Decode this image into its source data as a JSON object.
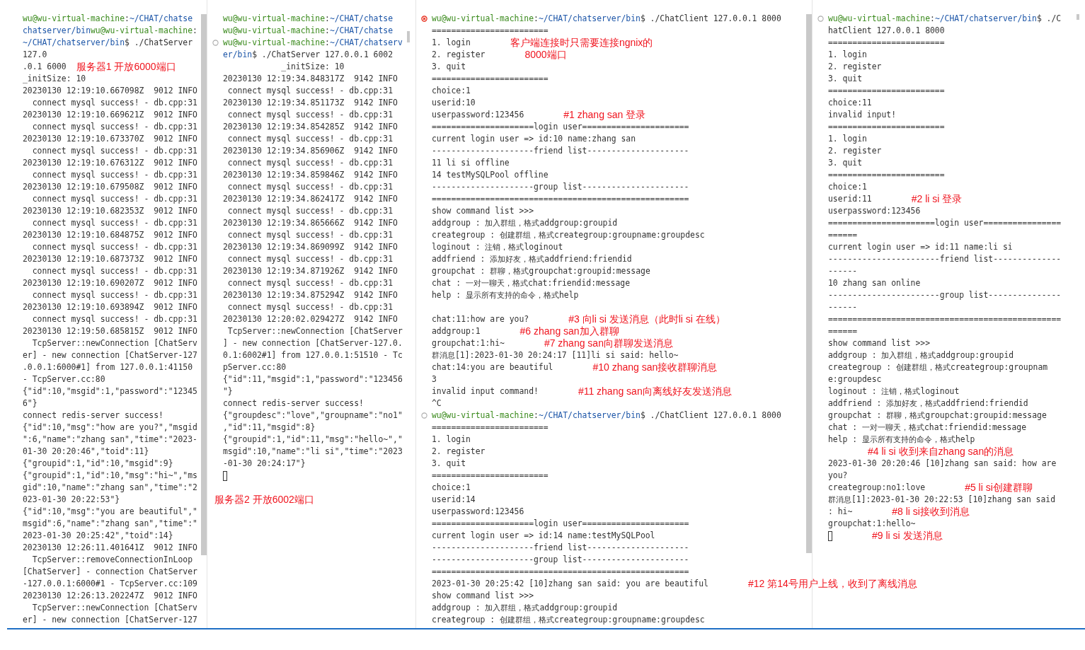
{
  "panes": [
    {
      "lines": [
        {
          "kind": "prompt",
          "parts": [
            {
              "kind": "user",
              "text": "wu@wu-virtual-machine"
            },
            {
              "kind": "plain",
              "text": ":"
            },
            {
              "kind": "path",
              "text": "~/CHAT/chatse"
            }
          ]
        },
        {
          "kind": "prompt",
          "parts": [
            {
              "kind": "path",
              "text": "chatserver/bin"
            },
            {
              "kind": "user",
              "text": "wu@wu-virtual-machine"
            },
            {
              "kind": "plain",
              "text": ":"
            }
          ]
        },
        {
          "kind": "prompt",
          "parts": [
            {
              "kind": "path",
              "text": "~/CHAT/chatserver/bin"
            },
            {
              "kind": "plain",
              "text": "$ ./ChatServer"
            }
          ]
        },
        {
          "kind": "text",
          "text": "127.0"
        },
        {
          "kind": "text",
          "text": ".0.1 6000",
          "note": "服务器1 开放6000端口"
        },
        {
          "kind": "text",
          "text": "_initSize: 10"
        },
        {
          "kind": "text",
          "text": "20230130 12:19:10.667098Z  9012 INFO"
        },
        {
          "kind": "text",
          "text": "  connect mysql success! - db.cpp:31"
        },
        {
          "kind": "text",
          "text": "20230130 12:19:10.669621Z  9012 INFO"
        },
        {
          "kind": "text",
          "text": "  connect mysql success! - db.cpp:31"
        },
        {
          "kind": "text",
          "text": "20230130 12:19:10.673370Z  9012 INFO"
        },
        {
          "kind": "text",
          "text": "  connect mysql success! - db.cpp:31"
        },
        {
          "kind": "text",
          "text": "20230130 12:19:10.676312Z  9012 INFO"
        },
        {
          "kind": "text",
          "text": "  connect mysql success! - db.cpp:31"
        },
        {
          "kind": "text",
          "text": "20230130 12:19:10.679508Z  9012 INFO"
        },
        {
          "kind": "text",
          "text": "  connect mysql success! - db.cpp:31"
        },
        {
          "kind": "text",
          "text": "20230130 12:19:10.682353Z  9012 INFO"
        },
        {
          "kind": "text",
          "text": "  connect mysql success! - db.cpp:31"
        },
        {
          "kind": "text",
          "text": "20230130 12:19:10.684875Z  9012 INFO"
        },
        {
          "kind": "text",
          "text": "  connect mysql success! - db.cpp:31"
        },
        {
          "kind": "text",
          "text": "20230130 12:19:10.687373Z  9012 INFO"
        },
        {
          "kind": "text",
          "text": "  connect mysql success! - db.cpp:31"
        },
        {
          "kind": "text",
          "text": "20230130 12:19:10.690207Z  9012 INFO"
        },
        {
          "kind": "text",
          "text": "  connect mysql success! - db.cpp:31"
        },
        {
          "kind": "text",
          "text": "20230130 12:19:10.693894Z  9012 INFO"
        },
        {
          "kind": "text",
          "text": "  connect mysql success! - db.cpp:31"
        },
        {
          "kind": "text",
          "text": "20230130 12:19:50.685815Z  9012 INFO"
        },
        {
          "kind": "text",
          "text": "  TcpServer::newConnection [ChatServ"
        },
        {
          "kind": "text",
          "text": "er] - new connection [ChatServer-127"
        },
        {
          "kind": "text",
          "text": ".0.0.1:6000#1] from 127.0.0.1:41150"
        },
        {
          "kind": "text",
          "text": "- TcpServer.cc:80"
        },
        {
          "kind": "text",
          "text": "{\"id\":10,\"msgid\":1,\"password\":\"12345"
        },
        {
          "kind": "text",
          "text": "6\"}"
        },
        {
          "kind": "text",
          "text": "connect redis-server success!"
        },
        {
          "kind": "text",
          "text": "{\"id\":10,\"msg\":\"how are you?\",\"msgid"
        },
        {
          "kind": "text",
          "text": "\":6,\"name\":\"zhang san\",\"time\":\"2023-"
        },
        {
          "kind": "text",
          "text": "01-30 20:20:46\",\"toid\":11}"
        },
        {
          "kind": "text",
          "text": "{\"groupid\":1,\"id\":10,\"msgid\":9}"
        },
        {
          "kind": "text",
          "text": "{\"groupid\":1,\"id\":10,\"msg\":\"hi~\",\"ms"
        },
        {
          "kind": "text",
          "text": "gid\":10,\"name\":\"zhang san\",\"time\":\"2"
        },
        {
          "kind": "text",
          "text": "023-01-30 20:22:53\"}"
        },
        {
          "kind": "text",
          "text": "{\"id\":10,\"msg\":\"you are beautiful\",\""
        },
        {
          "kind": "text",
          "text": "msgid\":6,\"name\":\"zhang san\",\"time\":\""
        },
        {
          "kind": "text",
          "text": "2023-01-30 20:25:42\",\"toid\":14}"
        },
        {
          "kind": "text",
          "text": "20230130 12:26:11.401641Z  9012 INFO"
        },
        {
          "kind": "text",
          "text": "  TcpServer::removeConnectionInLoop"
        },
        {
          "kind": "text",
          "text": "[ChatServer] - connection ChatServer"
        },
        {
          "kind": "text",
          "text": "-127.0.0.1:6000#1 - TcpServer.cc:109"
        },
        {
          "kind": "text",
          "text": "20230130 12:26:13.202247Z  9012 INFO"
        },
        {
          "kind": "text",
          "text": "  TcpServer::newConnection [ChatServ"
        },
        {
          "kind": "text",
          "text": "er] - new connection [ChatServer-127"
        }
      ]
    },
    {
      "lines": [
        {
          "kind": "prompt",
          "parts": [
            {
              "kind": "user",
              "text": "wu@wu-virtual-machine"
            },
            {
              "kind": "plain",
              "text": ":"
            },
            {
              "kind": "path",
              "text": "~/CHAT/chatse"
            }
          ]
        },
        {
          "kind": "prompt",
          "parts": [
            {
              "kind": "user",
              "text": "wu@wu-virtual-machine"
            },
            {
              "kind": "plain",
              "text": ":"
            },
            {
              "kind": "path",
              "text": "~/CHAT/chatse"
            }
          ]
        },
        {
          "kind": "prompt",
          "failed": false,
          "parts": [
            {
              "kind": "user",
              "text": "wu@wu-virtual-machine"
            },
            {
              "kind": "plain",
              "text": ":"
            },
            {
              "kind": "path",
              "text": "~/CHAT/chatserv"
            }
          ]
        },
        {
          "kind": "prompt",
          "parts": [
            {
              "kind": "path",
              "text": "er/bin"
            },
            {
              "kind": "plain",
              "text": "$ ./ChatServer 127.0.0.1 6002"
            }
          ]
        },
        {
          "kind": "text",
          "text": "            _initSize: 10"
        },
        {
          "kind": "text",
          "text": "20230130 12:19:34.848317Z  9142 INFO"
        },
        {
          "kind": "text",
          "text": " connect mysql success! - db.cpp:31"
        },
        {
          "kind": "text",
          "text": "20230130 12:19:34.851173Z  9142 INFO"
        },
        {
          "kind": "text",
          "text": " connect mysql success! - db.cpp:31"
        },
        {
          "kind": "text",
          "text": "20230130 12:19:34.854285Z  9142 INFO"
        },
        {
          "kind": "text",
          "text": " connect mysql success! - db.cpp:31"
        },
        {
          "kind": "text",
          "text": "20230130 12:19:34.856906Z  9142 INFO"
        },
        {
          "kind": "text",
          "text": " connect mysql success! - db.cpp:31"
        },
        {
          "kind": "text",
          "text": "20230130 12:19:34.859846Z  9142 INFO"
        },
        {
          "kind": "text",
          "text": " connect mysql success! - db.cpp:31"
        },
        {
          "kind": "text",
          "text": "20230130 12:19:34.862417Z  9142 INFO"
        },
        {
          "kind": "text",
          "text": " connect mysql success! - db.cpp:31"
        },
        {
          "kind": "text",
          "text": "20230130 12:19:34.865666Z  9142 INFO"
        },
        {
          "kind": "text",
          "text": " connect mysql success! - db.cpp:31"
        },
        {
          "kind": "text",
          "text": "20230130 12:19:34.869099Z  9142 INFO"
        },
        {
          "kind": "text",
          "text": " connect mysql success! - db.cpp:31"
        },
        {
          "kind": "text",
          "text": "20230130 12:19:34.871926Z  9142 INFO"
        },
        {
          "kind": "text",
          "text": " connect mysql success! - db.cpp:31"
        },
        {
          "kind": "text",
          "text": "20230130 12:19:34.875294Z  9142 INFO"
        },
        {
          "kind": "text",
          "text": " connect mysql success! - db.cpp:31"
        },
        {
          "kind": "text",
          "text": "20230130 12:20:02.029427Z  9142 INFO"
        },
        {
          "kind": "text",
          "text": " TcpServer::newConnection [ChatServer"
        },
        {
          "kind": "text",
          "text": "] - new connection [ChatServer-127.0."
        },
        {
          "kind": "text",
          "text": "0.1:6002#1] from 127.0.0.1:51510 - Tc"
        },
        {
          "kind": "text",
          "text": "pServer.cc:80"
        },
        {
          "kind": "text",
          "text": "{\"id\":11,\"msgid\":1,\"password\":\"123456"
        },
        {
          "kind": "text",
          "text": "\"}"
        },
        {
          "kind": "text",
          "text": "connect redis-server success!"
        },
        {
          "kind": "text",
          "text": "{\"groupdesc\":\"love\",\"groupname\":\"no1\""
        },
        {
          "kind": "text",
          "text": ",\"id\":11,\"msgid\":8}"
        },
        {
          "kind": "text",
          "text": "{\"groupid\":1,\"id\":11,\"msg\":\"hello~\",\""
        },
        {
          "kind": "text",
          "text": "msgid\":10,\"name\":\"li si\",\"time\":\"2023"
        },
        {
          "kind": "text",
          "text": "-01-30 20:24:17\"}"
        },
        {
          "kind": "cursor"
        },
        {
          "kind": "blank"
        },
        {
          "kind": "note",
          "note": "服务器2 开放6002端口"
        }
      ]
    },
    {
      "lines": [
        {
          "kind": "prompt",
          "failed": true,
          "parts": [
            {
              "kind": "user",
              "text": "wu@wu-virtual-machine"
            },
            {
              "kind": "plain",
              "text": ":"
            },
            {
              "kind": "path",
              "text": "~/CHAT/chatserver/bin"
            },
            {
              "kind": "plain",
              "text": "$ ./ChatClient 127.0.0.1 8000"
            }
          ]
        },
        {
          "kind": "text",
          "text": "========================"
        },
        {
          "kind": "text",
          "text": "1. login",
          "note": "客户端连接时只需要连接ngnix的"
        },
        {
          "kind": "text",
          "text": "2. register",
          "note": "8000端口"
        },
        {
          "kind": "text",
          "text": "3. quit"
        },
        {
          "kind": "text",
          "text": "========================"
        },
        {
          "kind": "text",
          "text": "choice:1"
        },
        {
          "kind": "text",
          "text": "userid:10"
        },
        {
          "kind": "text",
          "text": "userpassword:123456",
          "note": "#1 zhang san 登录"
        },
        {
          "kind": "text",
          "text": "=====================login user======================"
        },
        {
          "kind": "text",
          "text": "current login user => id:10 name:zhang san"
        },
        {
          "kind": "text",
          "text": "---------------------friend list---------------------"
        },
        {
          "kind": "text",
          "text": "11 li si offline"
        },
        {
          "kind": "text",
          "text": "14 testMySQLPool offline"
        },
        {
          "kind": "text",
          "text": "---------------------group list----------------------"
        },
        {
          "kind": "text",
          "text": "====================================================="
        },
        {
          "kind": "text",
          "text": "show command list >>>"
        },
        {
          "kind": "text",
          "text": "addgroup : 加入群组，格式addgroup:groupid"
        },
        {
          "kind": "text",
          "text": "creategroup : 创建群组，格式creategroup:groupname:groupdesc"
        },
        {
          "kind": "text",
          "text": "loginout : 注销，格式loginout"
        },
        {
          "kind": "text",
          "text": "addfriend : 添加好友，格式addfriend:friendid"
        },
        {
          "kind": "text",
          "text": "groupchat : 群聊，格式groupchat:groupid:message"
        },
        {
          "kind": "text",
          "text": "chat : 一对一聊天，格式chat:friendid:message"
        },
        {
          "kind": "text",
          "text": "help : 显示所有支持的命令，格式help"
        },
        {
          "kind": "blank"
        },
        {
          "kind": "text",
          "text": "chat:11:how are you?",
          "note": "#3 向li si 发送消息（此时li si 在线）"
        },
        {
          "kind": "text",
          "text": "addgroup:1",
          "note": "#6 zhang san加入群聊"
        },
        {
          "kind": "text",
          "text": "groupchat:1:hi~",
          "note": "#7 zhang san向群聊发送消息"
        },
        {
          "kind": "text",
          "text": "群消息[1]:2023-01-30 20:24:17 [11]li si said: hello~"
        },
        {
          "kind": "text",
          "text": "chat:14:you are beautiful",
          "note": "#10 zhang san接收群聊消息"
        },
        {
          "kind": "text",
          "text": "3"
        },
        {
          "kind": "text",
          "text": "invalid input command!",
          "note": "#11 zhang san向离线好友发送消息"
        },
        {
          "kind": "text",
          "text": "^C"
        },
        {
          "kind": "prompt",
          "failed": false,
          "parts": [
            {
              "kind": "user",
              "text": "wu@wu-virtual-machine"
            },
            {
              "kind": "plain",
              "text": ":"
            },
            {
              "kind": "path",
              "text": "~/CHAT/chatserver/bin"
            },
            {
              "kind": "plain",
              "text": "$ ./ChatClient 127.0.0.1 8000"
            }
          ]
        },
        {
          "kind": "text",
          "text": "========================"
        },
        {
          "kind": "text",
          "text": "1. login"
        },
        {
          "kind": "text",
          "text": "2. register"
        },
        {
          "kind": "text",
          "text": "3. quit"
        },
        {
          "kind": "text",
          "text": "========================"
        },
        {
          "kind": "text",
          "text": "choice:1"
        },
        {
          "kind": "text",
          "text": "userid:14"
        },
        {
          "kind": "text",
          "text": "userpassword:123456"
        },
        {
          "kind": "text",
          "text": "=====================login user======================"
        },
        {
          "kind": "text",
          "text": "current login user => id:14 name:testMySQLPool"
        },
        {
          "kind": "text",
          "text": "---------------------friend list---------------------"
        },
        {
          "kind": "text",
          "text": "---------------------group list----------------------"
        },
        {
          "kind": "text",
          "text": "====================================================="
        },
        {
          "kind": "text",
          "text": "2023-01-30 20:25:42 [10]zhang san said: you are beautiful",
          "note": "#12 第14号用户上线，收到了离线消息"
        },
        {
          "kind": "text",
          "text": "show command list >>>"
        },
        {
          "kind": "text",
          "text": "addgroup : 加入群组，格式addgroup:groupid"
        },
        {
          "kind": "text",
          "text": "creategroup : 创建群组，格式creategroup:groupname:groupdesc"
        }
      ]
    },
    {
      "lines": [
        {
          "kind": "prompt",
          "failed": false,
          "parts": [
            {
              "kind": "user",
              "text": "wu@wu-virtual-machine"
            },
            {
              "kind": "plain",
              "text": ":"
            },
            {
              "kind": "path",
              "text": "~/CHAT/chatserver/bin"
            },
            {
              "kind": "plain",
              "text": "$ ./C"
            }
          ]
        },
        {
          "kind": "text",
          "text": "hatClient 127.0.0.1 8000"
        },
        {
          "kind": "text",
          "text": "========================"
        },
        {
          "kind": "text",
          "text": "1. login"
        },
        {
          "kind": "text",
          "text": "2. register"
        },
        {
          "kind": "text",
          "text": "3. quit"
        },
        {
          "kind": "text",
          "text": "========================"
        },
        {
          "kind": "text",
          "text": "choice:11"
        },
        {
          "kind": "text",
          "text": "invalid input!"
        },
        {
          "kind": "text",
          "text": "========================"
        },
        {
          "kind": "text",
          "text": "1. login"
        },
        {
          "kind": "text",
          "text": "2. register"
        },
        {
          "kind": "text",
          "text": "3. quit"
        },
        {
          "kind": "text",
          "text": "========================"
        },
        {
          "kind": "text",
          "text": "choice:1"
        },
        {
          "kind": "text",
          "text": "userid:11",
          "note": "#2 li si 登录"
        },
        {
          "kind": "text",
          "text": "userpassword:123456"
        },
        {
          "kind": "text",
          "text": "======================login user================"
        },
        {
          "kind": "text",
          "text": "======"
        },
        {
          "kind": "text",
          "text": "current login user => id:11 name:li si"
        },
        {
          "kind": "text",
          "text": "-----------------------friend list--------------"
        },
        {
          "kind": "text",
          "text": "------"
        },
        {
          "kind": "text",
          "text": "10 zhang san online"
        },
        {
          "kind": "text",
          "text": "-----------------------group list---------------"
        },
        {
          "kind": "text",
          "text": "------"
        },
        {
          "kind": "text",
          "text": "================================================"
        },
        {
          "kind": "text",
          "text": "======"
        },
        {
          "kind": "text",
          "text": "show command list >>>"
        },
        {
          "kind": "text",
          "text": "addgroup : 加入群组，格式addgroup:groupid"
        },
        {
          "kind": "text",
          "text": "creategroup : 创建群组，格式creategroup:groupnam"
        },
        {
          "kind": "text",
          "text": "e:groupdesc"
        },
        {
          "kind": "text",
          "text": "loginout : 注销，格式loginout"
        },
        {
          "kind": "text",
          "text": "addfriend : 添加好友，格式addfriend:friendid"
        },
        {
          "kind": "text",
          "text": "groupchat : 群聊，格式groupchat:groupid:message"
        },
        {
          "kind": "text",
          "text": "chat : 一对一聊天，格式chat:friendid:message"
        },
        {
          "kind": "text",
          "text": "help : 显示所有支持的命令，格式help"
        },
        {
          "kind": "note",
          "note": "#4 li si 收到来自zhang san的消息"
        },
        {
          "kind": "text",
          "text": "2023-01-30 20:20:46 [10]zhang san said: how are"
        },
        {
          "kind": "text",
          "text": "you?"
        },
        {
          "kind": "text",
          "text": "creategroup:no1:love",
          "note": "#5 li si创建群聊"
        },
        {
          "kind": "text",
          "text": "群消息[1]:2023-01-30 20:22:53 [10]zhang san said"
        },
        {
          "kind": "text",
          "text": ": hi~",
          "note": "#8 li si接收到消息"
        },
        {
          "kind": "text",
          "text": "groupchat:1:hello~"
        },
        {
          "kind": "cursor",
          "note": "#9 li si 发送消息"
        }
      ]
    }
  ]
}
